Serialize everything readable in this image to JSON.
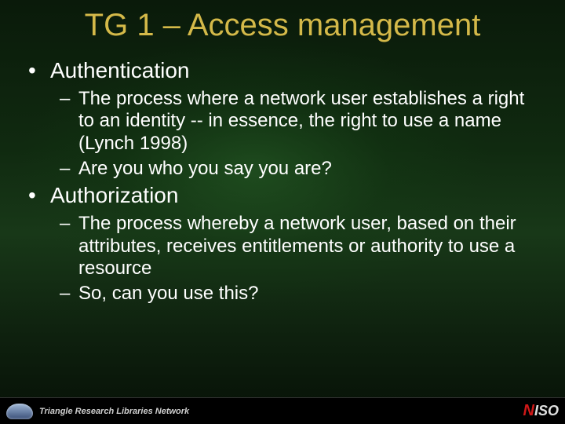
{
  "title": "TG 1 – Access management",
  "bullets": {
    "b1": "Authentication",
    "b1_subs": {
      "s1": "The process where a network user establishes a right to an identity -- in essence, the right to use a name (Lynch 1998)",
      "s2": "Are you who you say you are?"
    },
    "b2": "Authorization",
    "b2_subs": {
      "s1": "The process whereby a network user, based on their attributes, receives entitlements or authority to use a resource",
      "s2": "So, can you use this?"
    }
  },
  "footer": {
    "trln": "Triangle Research Libraries Network",
    "niso_n": "N",
    "niso_iso": "ISO"
  },
  "glyphs": {
    "bullet": "•",
    "dash": "–"
  }
}
